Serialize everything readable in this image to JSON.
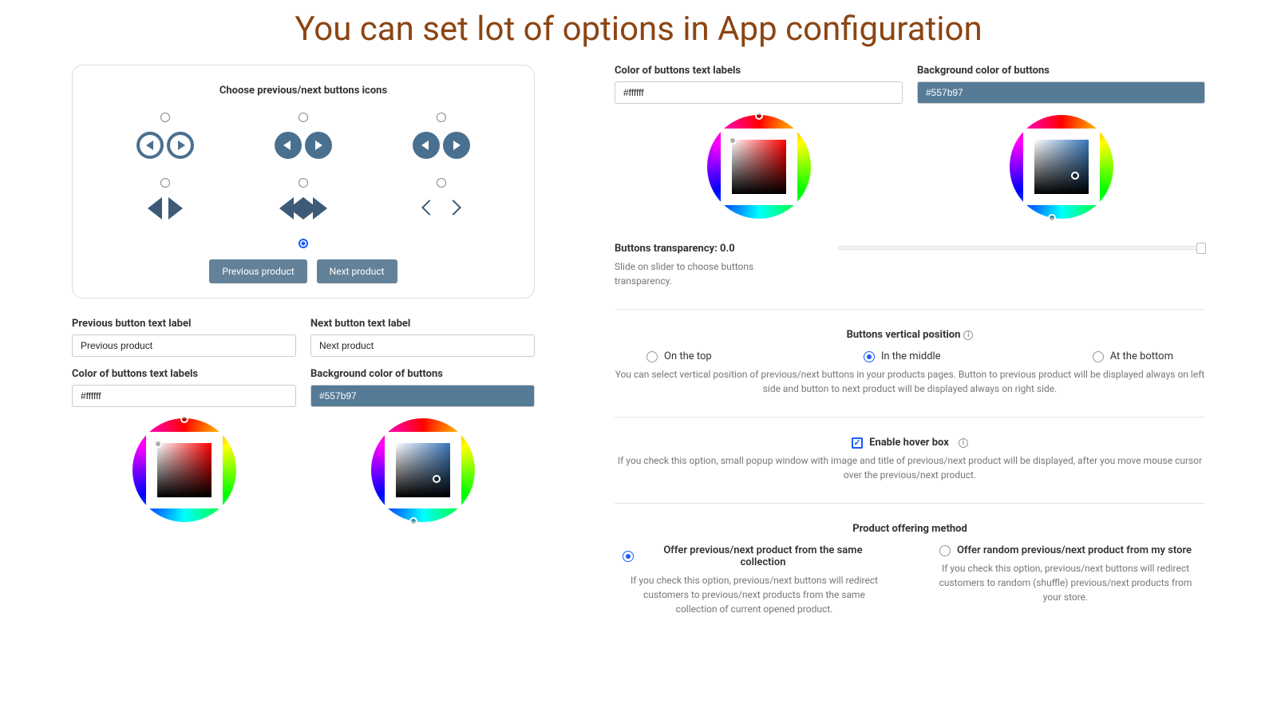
{
  "title": "You can set lot of options in App configuration",
  "icon_card": {
    "heading": "Choose previous/next buttons icons",
    "preview_prev": "Previous product",
    "preview_next": "Next product"
  },
  "labels": {
    "prev_label": "Previous button text label",
    "next_label": "Next button text label",
    "prev_value": "Previous product",
    "next_value": "Next product"
  },
  "colors": {
    "text_label": "Color of buttons text labels",
    "text_value": "#ffffff",
    "bg_label": "Background color of buttons",
    "bg_value": "#557b97"
  },
  "transparency": {
    "heading": "Buttons transparency: 0.0",
    "help": "Slide on slider to choose buttons transparency."
  },
  "vertical_pos": {
    "heading": "Buttons vertical position",
    "opt_top": "On the top",
    "opt_mid": "In the middle",
    "opt_bot": "At the bottom",
    "help": "You can select vertical position of previous/next buttons in your products pages. Button to previous product will be displayed always on left side and button to next product will be displayed always on right side."
  },
  "hover": {
    "label": "Enable hover box",
    "help": "If you check this option, small popup window with image and title of previous/next product will be displayed, after you move mouse cursor over the previous/next product."
  },
  "offering": {
    "heading": "Product offering method",
    "opt_same": "Offer previous/next product from the same collection",
    "help_same": "If you check this option, previous/next buttons will redirect customers to previous/next products from the same collection of current opened product.",
    "opt_rand": "Offer random previous/next product from my store",
    "help_rand": "If you check this option, previous/next buttons will redirect customers to random (shuffle) previous/next products from your store."
  }
}
